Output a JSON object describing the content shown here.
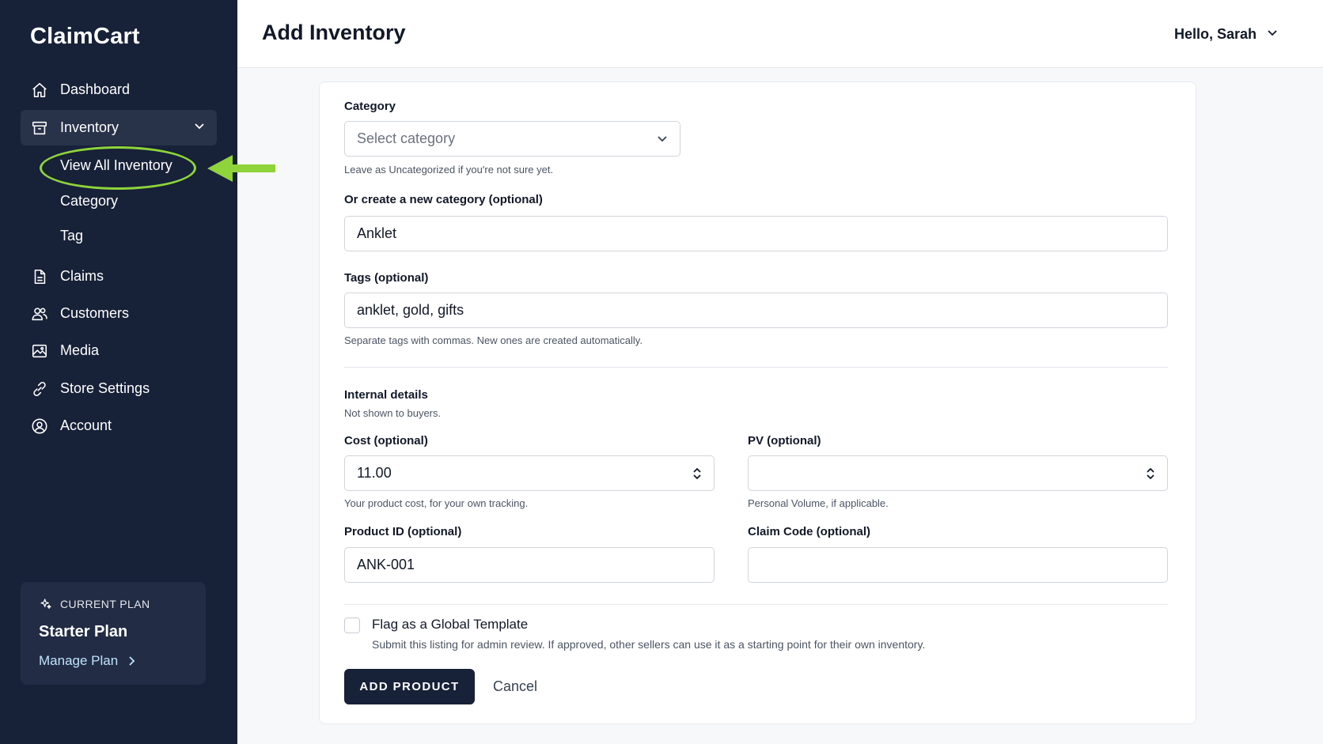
{
  "app": {
    "brand": "ClaimCart"
  },
  "sidebar": {
    "items": [
      {
        "label": "Dashboard",
        "icon": "home-icon"
      },
      {
        "label": "Inventory",
        "icon": "archive-box-icon"
      },
      {
        "label": "Claims",
        "icon": "document-icon"
      },
      {
        "label": "Customers",
        "icon": "users-icon"
      },
      {
        "label": "Media",
        "icon": "image-icon"
      },
      {
        "label": "Store Settings",
        "icon": "link-icon"
      },
      {
        "label": "Account",
        "icon": "user-circle-icon"
      }
    ],
    "inventory_sub": [
      "View All Inventory",
      "Category",
      "Tag"
    ],
    "plan": {
      "label": "CURRENT PLAN",
      "name": "Starter Plan",
      "manage": "Manage Plan"
    },
    "colors": {
      "background": "#172138",
      "highlight": "#8ed43a"
    }
  },
  "header": {
    "title": "Add Inventory",
    "user": "Hello, Sarah"
  },
  "form": {
    "category": {
      "label": "Category",
      "placeholder": "Select category",
      "hint": "Leave as Uncategorized if you're not sure yet."
    },
    "new_category": {
      "label": "Or create a new category (optional)",
      "value": "Anklet"
    },
    "tags": {
      "label": "Tags (optional)",
      "value": "anklet, gold, gifts",
      "hint": "Separate tags with commas. New ones are created automatically."
    },
    "internal": {
      "title": "Internal details",
      "subtitle": "Not shown to buyers."
    },
    "cost": {
      "label": "Cost (optional)",
      "value": "11.00",
      "hint": "Your product cost, for your own tracking."
    },
    "pv": {
      "label": "PV (optional)",
      "value": "",
      "hint": "Personal Volume, if applicable."
    },
    "product_id": {
      "label": "Product ID (optional)",
      "value": "ANK-001"
    },
    "claim_code": {
      "label": "Claim Code (optional)",
      "value": ""
    },
    "global_template": {
      "label": "Flag as a Global Template",
      "hint": "Submit this listing for admin review. If approved, other sellers can use it as a starting point for their own inventory."
    },
    "submit": "ADD PRODUCT",
    "cancel": "Cancel"
  }
}
